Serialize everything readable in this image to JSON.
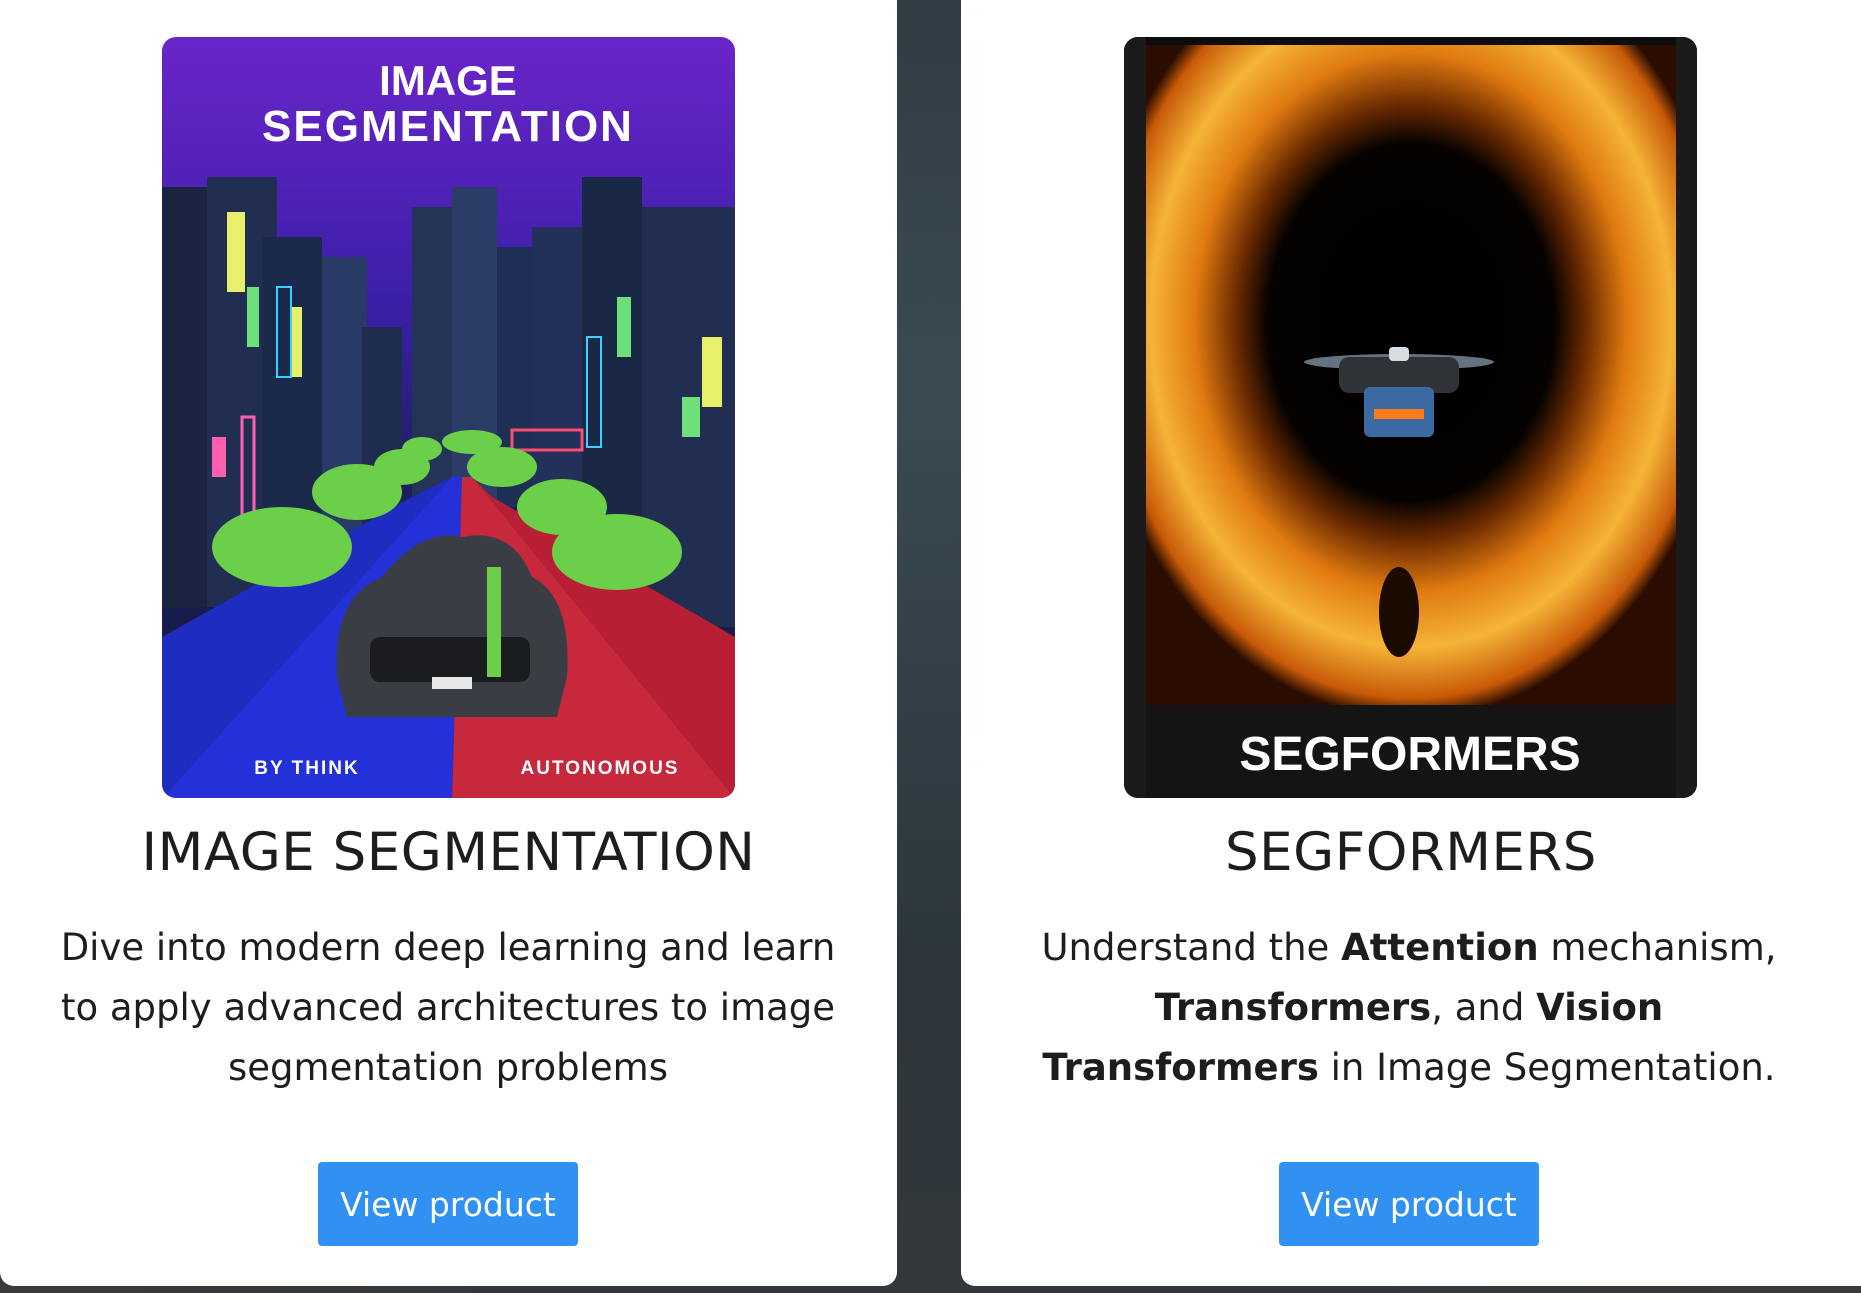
{
  "cards": [
    {
      "cover": {
        "title_line1": "IMAGE",
        "title_line2": "SEGMENTATION",
        "footer_left": "BY THINK",
        "footer_right": "AUTONOMOUS"
      },
      "title": "IMAGE SEGMENTATION",
      "description": "Dive into modern deep learning and learn to apply advanced architectures to image segmentation problems",
      "button_label": "View product"
    },
    {
      "cover": {
        "title": "SEGFORMERS"
      },
      "title": "SEGFORMERS",
      "description": {
        "p1": "Understand the ",
        "b1": "Attention",
        "p2": " mechanism, ",
        "b2": "Transformers",
        "p3": ", and ",
        "b3": "Vision Transformers",
        "p4": " in Image Segmentation."
      },
      "button_label": "View product"
    }
  ],
  "colors": {
    "button": "#3091f2",
    "card_bg": "#ffffff",
    "page_bg": "#2f393e"
  }
}
